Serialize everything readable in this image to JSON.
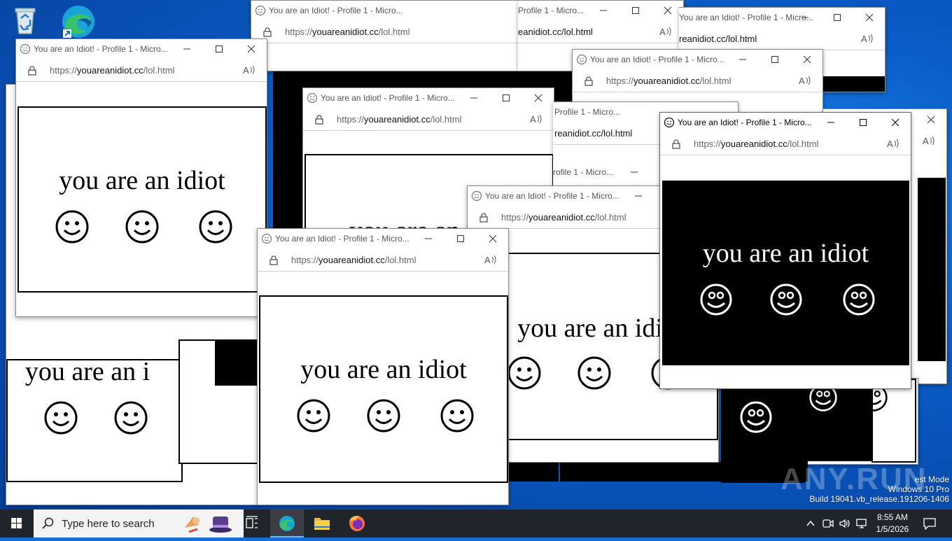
{
  "desktop": {
    "icons": [
      {
        "label": "Rec",
        "name": "recycle-bin"
      },
      {
        "label": "",
        "name": "edge"
      }
    ],
    "watermark": {
      "line1": "est Mode",
      "line2": "Windows 10 Pro",
      "line3": "Build 19041.vb_release.191206-1406",
      "logo": "ANY.RUN"
    }
  },
  "popup": {
    "title": "You are an Idiot! - Profile 1 - Micro...",
    "title_partial_a": "Profile 1 - Micro...",
    "title_partial_b": "rofile 1 - Micro...",
    "title_partial_c": "You are an Idiot! - Profile 1 - Micro...",
    "url_scheme": "https://",
    "url_domain": "youareanidiot.cc",
    "url_path": "/lol.html",
    "url_partial": "eanidiot.cc/lol.html",
    "url_partial_b": "reanidiot.cc/lol.html",
    "message": "you are an idiot",
    "message_cut_a": "you are an i",
    "message_cut_b": "you are an idi",
    "message_cut_c": "you are an"
  },
  "taskbar": {
    "search_placeholder": "Type here to search",
    "time": "8:55 AM",
    "date": "1/5/2026",
    "apps": [
      "task-view",
      "edge",
      "file-explorer",
      "firefox"
    ]
  },
  "colors": {
    "accent": "#76b9ed",
    "taskbar": "#20242b",
    "desktop": "#0a5cc8"
  }
}
